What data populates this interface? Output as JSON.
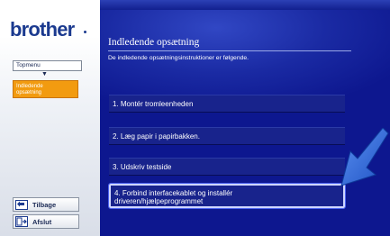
{
  "brand": {
    "logo_text": "brother",
    "color": "#1b3a8f"
  },
  "sidebar": {
    "nav_top_label": "Topmenu",
    "nav_arrow": "▼",
    "nav_current_label": "Indledende\nopsætning",
    "back_label": "Tilbage",
    "exit_label": "Afslut",
    "back_icon": "back-arrow-icon",
    "exit_icon": "exit-icon",
    "accent_color": "#f29b10"
  },
  "main": {
    "title": "Indledende opsætning",
    "subtitle": "De indledende opsætningsinstruktioner er følgende.",
    "background_color": "#0d178f",
    "steps": [
      {
        "label": "1. Montér tromleenheden"
      },
      {
        "label": "2. Læg papir i papirbakken."
      },
      {
        "label": "3. Udskriv testside"
      },
      {
        "label": "4. Forbind interfacekablet og installér\ndriveren/hjælpeprogrammet",
        "highlighted": true
      }
    ]
  },
  "pointer": {
    "icon": "pointer-arrow-icon",
    "color": "#2d67d8"
  }
}
